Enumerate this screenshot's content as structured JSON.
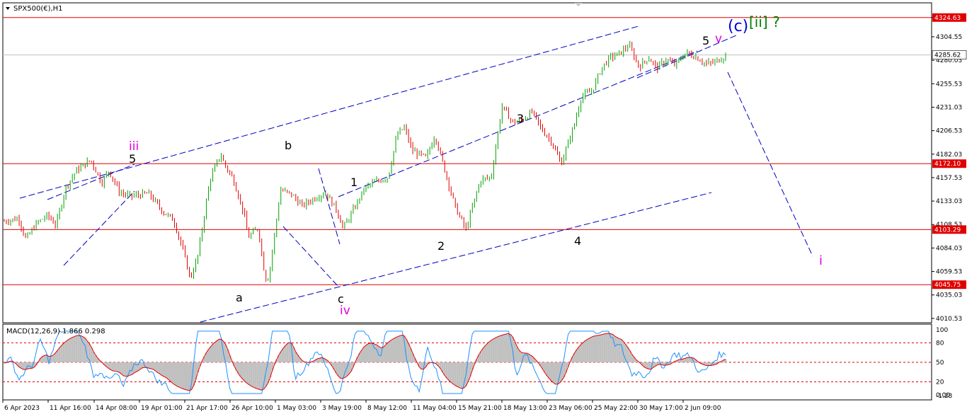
{
  "window": {
    "symbol_label": "SPX500(€),H1",
    "menu_icon": "triangle-down-icon"
  },
  "colors": {
    "background": "#ffffff",
    "grid_frame": "#000000",
    "bull_candle": "#00a000",
    "bear_candle": "#e00000",
    "level_line": "#e00000",
    "channel_line": "#0000c0",
    "current_price_line": "#c0c0c0",
    "wave_black": "#000000",
    "wave_magenta": "#e000e0",
    "wave_blue": "#0000e0",
    "wave_green": "#008000",
    "macd_histogram": "#c0c0c0",
    "macd_line": "#1e90ff",
    "signal_line": "#e00000",
    "macd_levels": "#e00000",
    "label_bg": "#e00000",
    "label_text": "#ffffff"
  },
  "chart_data": [
    {
      "type": "candlestick",
      "symbol": "SPX500(€)",
      "timeframe": "H1",
      "x_ticks": [
        "6 Apr 2023",
        "11 Apr 16:00",
        "14 Apr 08:00",
        "19 Apr 01:00",
        "21 Apr 17:00",
        "26 Apr 10:00",
        "1 May 03:00",
        "3 May 19:00",
        "8 May 12:00",
        "11 May 04:00",
        "15 May 21:00",
        "18 May 13:00",
        "23 May 06:00",
        "25 May 22:00",
        "30 May 17:00",
        "2 Jun 09:00"
      ],
      "y_ticks": [
        "4324.63",
        "4304.55",
        "4280.03",
        "4255.53",
        "4231.03",
        "4206.53",
        "4182.03",
        "4157.53",
        "4133.03",
        "4108.53",
        "4084.03",
        "4059.53",
        "4035.03",
        "4010.53"
      ],
      "ylim": [
        4006,
        4340
      ],
      "price_path": {
        "x": [
          0,
          0.02,
          0.03,
          0.045,
          0.06,
          0.072,
          0.085,
          0.1,
          0.12,
          0.135,
          0.145,
          0.16,
          0.175,
          0.2,
          0.22,
          0.235,
          0.248,
          0.258,
          0.268,
          0.285,
          0.3,
          0.305,
          0.318,
          0.333,
          0.338,
          0.352,
          0.362,
          0.367,
          0.383,
          0.398,
          0.413,
          0.43,
          0.445,
          0.46,
          0.47,
          0.48,
          0.5,
          0.512,
          0.532,
          0.545,
          0.555,
          0.565,
          0.585,
          0.597,
          0.612,
          0.625,
          0.64,
          0.648,
          0.66,
          0.675,
          0.69,
          0.705,
          0.718,
          0.732,
          0.745,
          0.758,
          0.772,
          0.79,
          0.8,
          0.815,
          0.828,
          0.84,
          0.853,
          0.866,
          0.88,
          0.893,
          0.905,
          0.918,
          0.93,
          0.945,
          0.96,
          0.973,
          0.985,
          1
        ],
        "y": [
          4112,
          4115,
          4093,
          4110,
          4118,
          4108,
          4147,
          4165,
          4176,
          4152,
          4165,
          4142,
          4138,
          4141,
          4122,
          4113,
          4081,
          4052,
          4074,
          4155,
          4182,
          4172,
          4155,
          4118,
          4095,
          4105,
          4052,
          4054,
          4145,
          4140,
          4128,
          4136,
          4142,
          4125,
          4105,
          4118,
          4147,
          4152,
          4158,
          4203,
          4210,
          4186,
          4178,
          4202,
          4162,
          4127,
          4103,
          4124,
          4155,
          4158,
          4232,
          4215,
          4218,
          4226,
          4208,
          4196,
          4172,
          4212,
          4242,
          4248,
          4272,
          4283,
          4287,
          4296,
          4273,
          4283,
          4272,
          4281,
          4275,
          4288,
          4283,
          4276,
          4278,
          4285
        ]
      },
      "levels": [
        {
          "price": 4324.63,
          "label": "4324.63"
        },
        {
          "price": 4172.1,
          "label": "4172.10"
        },
        {
          "price": 4103.29,
          "label": "4103.29"
        },
        {
          "price": 4045.75,
          "label": "4045.75"
        }
      ],
      "current_price": {
        "price": 4285.62,
        "label": "4285.62"
      },
      "wave_labels": [
        {
          "text": "iii",
          "color": "magenta"
        },
        {
          "text": "5",
          "color": "black"
        },
        {
          "text": "b",
          "color": "black"
        },
        {
          "text": "a",
          "color": "black"
        },
        {
          "text": "c",
          "color": "black"
        },
        {
          "text": "iv",
          "color": "magenta"
        },
        {
          "text": "1",
          "color": "black"
        },
        {
          "text": "2",
          "color": "black"
        },
        {
          "text": "3",
          "color": "black"
        },
        {
          "text": "4",
          "color": "black"
        },
        {
          "text": "5",
          "color": "black"
        },
        {
          "text": "v",
          "color": "magenta"
        },
        {
          "text": "(c)",
          "color": "blue"
        },
        {
          "text": "[ii] ?",
          "color": "green"
        },
        {
          "text": "i",
          "color": "magenta"
        }
      ]
    },
    {
      "type": "line",
      "indicator": "MACD",
      "legend": "MACD(12,26,9) 1.866 0.298",
      "series": [
        {
          "name": "MACD",
          "values": [
            1.866
          ]
        },
        {
          "name": "Signal",
          "values": [
            0.298
          ]
        }
      ],
      "levels": [
        "80",
        "50",
        "20"
      ],
      "y_ticks": [
        "100",
        "80",
        "50",
        "0.00",
        "20",
        "-1.28"
      ],
      "ylim": [
        -1.28,
        100
      ]
    }
  ]
}
